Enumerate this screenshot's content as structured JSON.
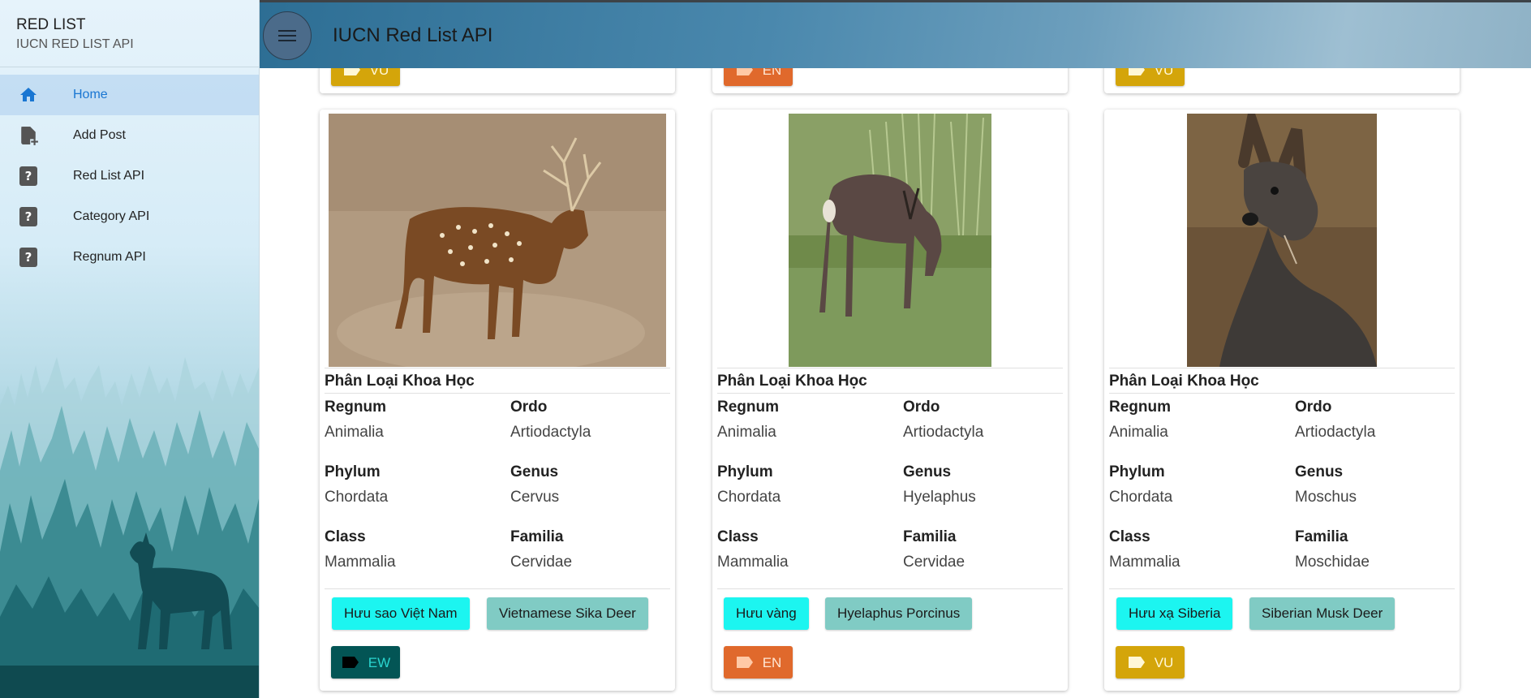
{
  "sidebar": {
    "title": "RED LIST",
    "subtitle": "IUCN RED LIST API",
    "items": [
      {
        "label": "Home",
        "icon": "home-icon",
        "active": true
      },
      {
        "label": "Add Post",
        "icon": "add-document-icon"
      },
      {
        "label": "Red List API",
        "icon": "help-icon"
      },
      {
        "label": "Category API",
        "icon": "help-icon"
      },
      {
        "label": "Regnum API",
        "icon": "help-icon"
      }
    ]
  },
  "header": {
    "title": "IUCN Red List API"
  },
  "previous_row": [
    {
      "status": "VU",
      "color": "#d4a50a"
    },
    {
      "status": "EN",
      "color": "#e0692c"
    },
    {
      "status": "VU",
      "color": "#d4a50a"
    }
  ],
  "cards": [
    {
      "section_title": "Phân Loại Khoa Học",
      "labels": {
        "regnum": "Regnum",
        "ordo": "Ordo",
        "phylum": "Phylum",
        "genus": "Genus",
        "class": "Class",
        "familia": "Familia"
      },
      "regnum": "Animalia",
      "ordo": "Artiodactyla",
      "phylum": "Chordata",
      "genus": "Cervus",
      "class": "Mammalia",
      "familia": "Cervidae",
      "vietnamese_name": "Hưu sao Việt Nam",
      "english_name": "Vietnamese Sika Deer",
      "status": "EW",
      "status_color": "#035555",
      "status_text_color": "#2ad5cf",
      "image": "sika-deer-photo"
    },
    {
      "section_title": "Phân Loại Khoa Học",
      "labels": {
        "regnum": "Regnum",
        "ordo": "Ordo",
        "phylum": "Phylum",
        "genus": "Genus",
        "class": "Class",
        "familia": "Familia"
      },
      "regnum": "Animalia",
      "ordo": "Artiodactyla",
      "phylum": "Chordata",
      "genus": "Hyelaphus",
      "class": "Mammalia",
      "familia": "Cervidae",
      "vietnamese_name": "Hưu vàng",
      "english_name": "Hyelaphus Porcinus",
      "status": "EN",
      "status_color": "#e0692c",
      "status_text_color": "#ffe6d3",
      "image": "hog-deer-photo"
    },
    {
      "section_title": "Phân Loại Khoa Học",
      "labels": {
        "regnum": "Regnum",
        "ordo": "Ordo",
        "phylum": "Phylum",
        "genus": "Genus",
        "class": "Class",
        "familia": "Familia"
      },
      "regnum": "Animalia",
      "ordo": "Artiodactyla",
      "phylum": "Chordata",
      "genus": "Moschus",
      "class": "Mammalia",
      "familia": "Moschidae",
      "vietnamese_name": "Hưu xạ Siberia",
      "english_name": "Siberian Musk Deer",
      "status": "VU",
      "status_color": "#d4a50a",
      "status_text_color": "#fff7d6",
      "image": "musk-deer-photo"
    }
  ]
}
